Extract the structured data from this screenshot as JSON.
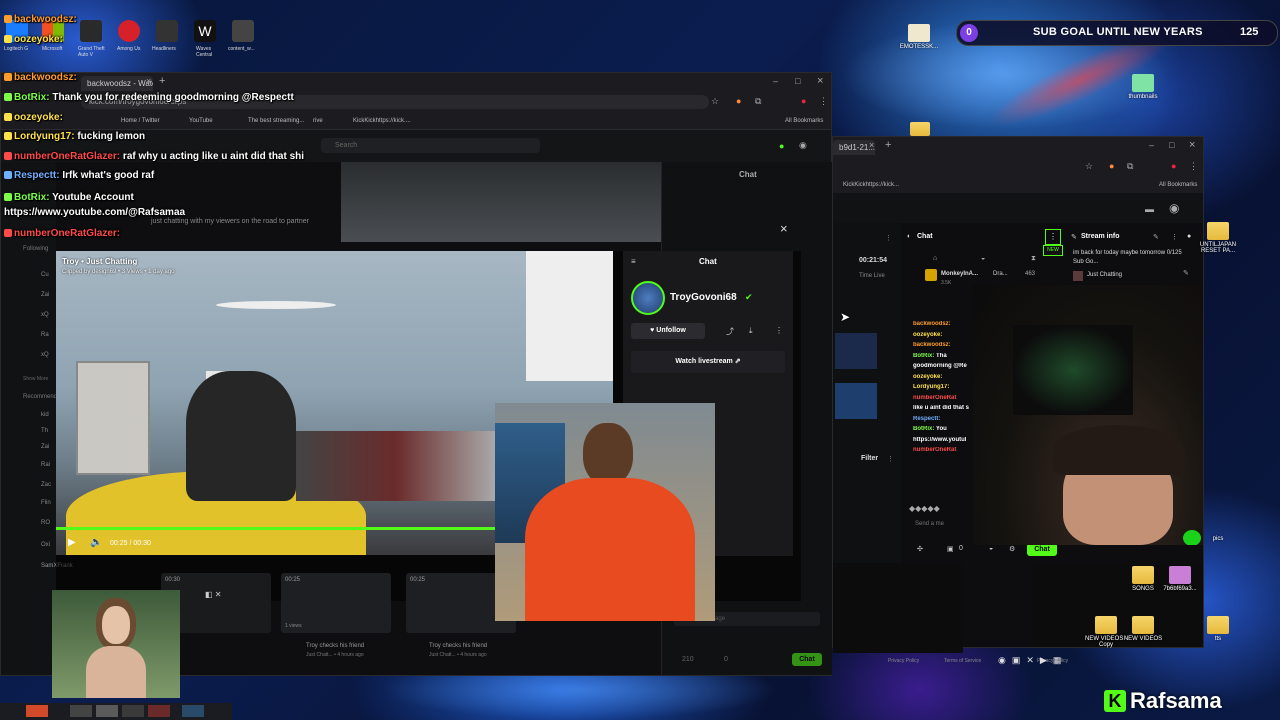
{
  "overlay": {
    "chat_lines": [
      {
        "user": "backwoodsz:",
        "msg": "",
        "color": "#ff9d2e"
      },
      {
        "user": "oozeyoke:",
        "msg": "",
        "color": "#ffe14a"
      },
      {
        "user": "backwoodsz:",
        "msg": "",
        "color": "#ff9d2e"
      },
      {
        "user": "BotRix:",
        "msg": "Thank you for redeeming goodmorning @Respectt",
        "color": "#7dff4a"
      },
      {
        "user": "oozeyoke:",
        "msg": "",
        "color": "#ffe14a"
      },
      {
        "user": "Lordyung17:",
        "msg": "fucking lemon",
        "color": "#ffe14a"
      },
      {
        "user": "numberOneRatGlazer:",
        "msg": "raf why u acting like u aint did that shi",
        "color": "#ff4a4a"
      },
      {
        "user": "Respectt:",
        "msg": "Irfk what's good raf",
        "color": "#6fb0ff"
      },
      {
        "user": "BotRix:",
        "msg": "Youtube Account",
        "color": "#7dff4a"
      },
      {
        "user": "",
        "msg": "https://www.youtube.com/@Rafsamaa",
        "color": "#ffffff"
      },
      {
        "user": "numberOneRatGlazer:",
        "msg": "",
        "color": "#ff4a4a"
      }
    ],
    "sub_goal": {
      "left": "0",
      "label": "SUB GOAL UNTIL NEW YEARS",
      "right": "125"
    },
    "brand": {
      "logo": "K",
      "name": "Rafsama"
    },
    "top_icons": [
      "Logitech G",
      "Microsoft",
      "Grand Theft Auto V",
      "Among Us",
      "Headliners",
      "Waves Central",
      "content_w..."
    ]
  },
  "browser1": {
    "tab_title": "backwoodsz - Watch Li...",
    "address": "kick.com/troygovoni68/clips",
    "bookmarks": [
      "Home / Twitter",
      "YouTube",
      "The best streaming...",
      "rive",
      "KickKickhttps://kick...."
    ],
    "all_bookmarks": "All Bookmarks",
    "search_placeholder": "Search",
    "chat_header": "Chat",
    "following_label": "Following",
    "recommended_label": "Recommended",
    "show_more": "Show More",
    "stream_title_dim": "just chatting with my viewers on the road to partner",
    "clip": {
      "title": "Troy • Just Chatting",
      "meta": "Clipped by design69 • 3 Views • 1 day ago",
      "time": "00:25 / 00:30",
      "progress": 0.83
    },
    "side_panel": {
      "chat_title": "Chat",
      "channel": "TroyGovoni68",
      "unfollow": "Unfollow",
      "watch": "Watch livestream"
    },
    "clip_cards": [
      {
        "duration": "00:30",
        "title": "Troy checks his friend",
        "meta": "1 views"
      },
      {
        "duration": "00:25",
        "title": "Troy checks his friend",
        "meta": "Just Chatt... • 4 hours ago"
      },
      {
        "duration": "00:25",
        "title": "Troy checks his friend",
        "meta": "Just Chatt... • 4 hours ago"
      }
    ],
    "sidebar_users": [
      "SamXFrank",
      "Oxi",
      "Flin",
      "RO",
      "Zac",
      "Rai",
      "Flr",
      "kid",
      "Th",
      "Zai",
      "xQ",
      "Ra",
      "xQ",
      "Zai",
      "Cu"
    ],
    "bottom_count": "210",
    "bottom_count2": "0",
    "chat_button": "Chat",
    "send_placeholder": "Send a message"
  },
  "browser2": {
    "tab_title": "b9d1-21...",
    "all_bookmarks": "All Bookmarks",
    "bookmark": "KickKickhttps://kick...",
    "time": "00:21:54",
    "time_live": "Time Live",
    "chat_label": "Chat",
    "stream_info": "Stream info",
    "stream_desc": "im back for today maybe tomorrow 0/125 Sub Go...",
    "category": "Just Chatting",
    "top_user": "MonkeyInA...",
    "top_user_sub": "3.5K",
    "top_user2": "Dra...",
    "count": "463",
    "filter": "Filter",
    "send_placeholder": "Send a me",
    "viewer_count": "0",
    "chat_button": "Chat",
    "new_badge": "NEW",
    "privacy": "Privacy Policy",
    "terms": "Terms of Service",
    "mini_chat": [
      {
        "user": "backwoodsz:",
        "msg": "",
        "color": "#ff9d2e"
      },
      {
        "user": "oozeyoke:",
        "msg": "",
        "color": "#ffe14a"
      },
      {
        "user": "backwoodsz:",
        "msg": "",
        "color": "#ff9d2e"
      },
      {
        "user": "BotRix:",
        "msg": "Tha",
        "color": "#7dff4a"
      },
      {
        "user": "",
        "msg": "goodmorning @Re",
        "color": "#ffffff"
      },
      {
        "user": "oozeyoke:",
        "msg": "",
        "color": "#ffe14a"
      },
      {
        "user": "Lordyung17:",
        "msg": "",
        "color": "#ffe14a"
      },
      {
        "user": "numberOneRat",
        "msg": "",
        "color": "#ff4a4a"
      },
      {
        "user": "",
        "msg": "like u aint did that s",
        "color": "#ffffff"
      },
      {
        "user": "Respectt:",
        "msg": "",
        "color": "#6fb0ff"
      },
      {
        "user": "BotRix:",
        "msg": "You",
        "color": "#7dff4a"
      },
      {
        "user": "",
        "msg": "https://www.youtul",
        "color": "#ffffff"
      },
      {
        "user": "numberOneRat",
        "msg": "",
        "color": "#ff4a4a"
      }
    ]
  },
  "desktop_icons": [
    {
      "label": "EMOTESSK..."
    },
    {
      "label": "thumbnails"
    },
    {
      "label": "UNTILJAPAN RESET PA..."
    },
    {
      "label": "pics"
    },
    {
      "label": "SONGS"
    },
    {
      "label": "7b6bf69a3..."
    },
    {
      "label": "NEW VIDEOS - Copy"
    },
    {
      "label": "NEW VIDEOS"
    },
    {
      "label": "tts"
    }
  ]
}
